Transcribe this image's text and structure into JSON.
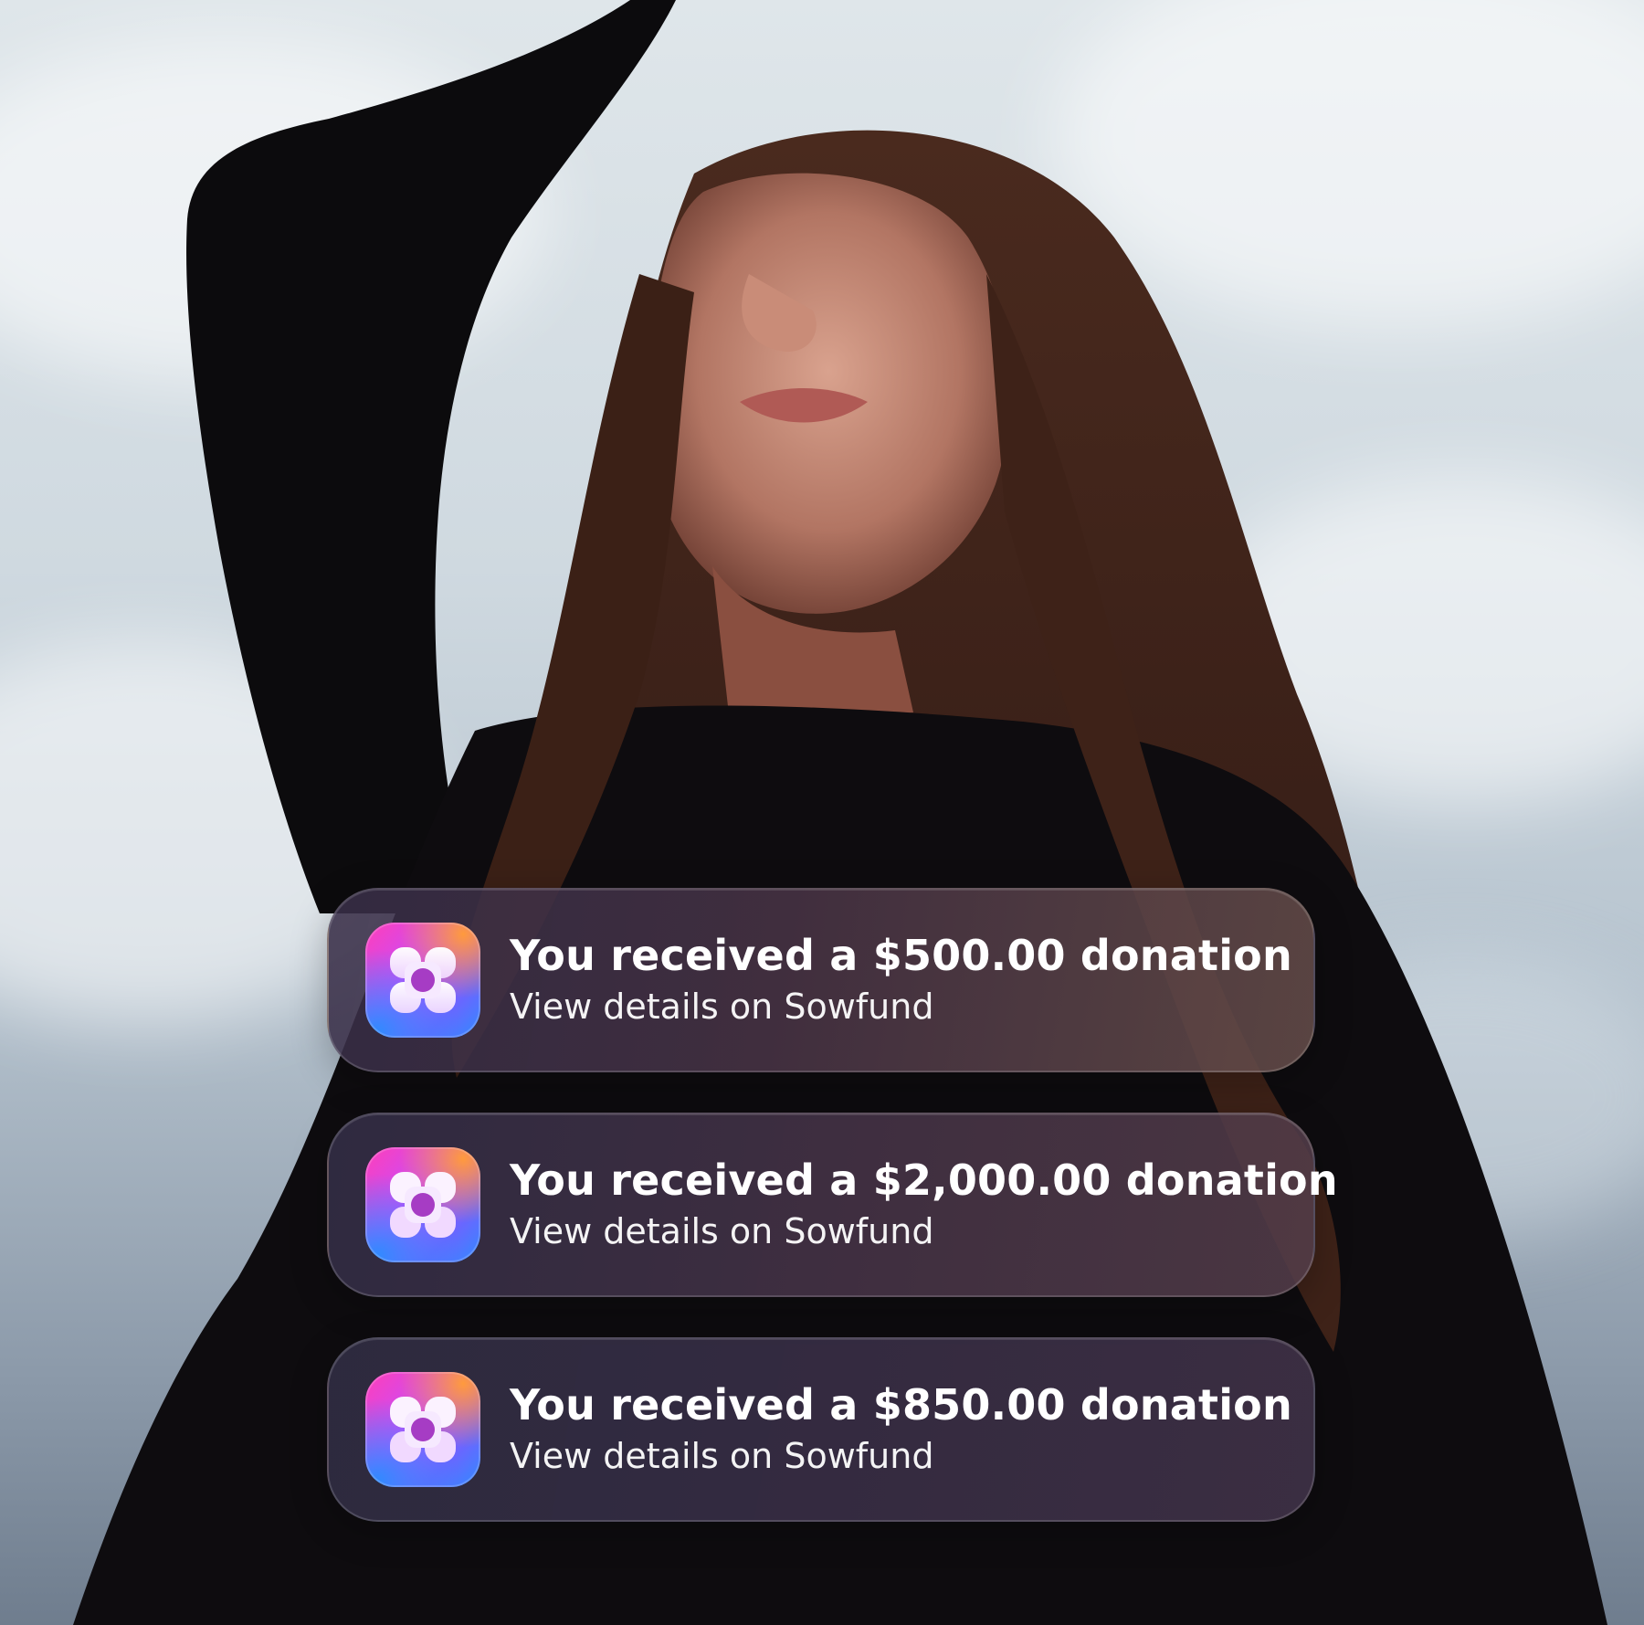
{
  "notifications": [
    {
      "title": "You received a $500.00 donation",
      "subtitle": "View details on Sowfund",
      "app_icon": "sowfund-flower-icon"
    },
    {
      "title": "You received a $2,000.00 donation",
      "subtitle": "View details on Sowfund",
      "app_icon": "sowfund-flower-icon"
    },
    {
      "title": "You received a $850.00 donation",
      "subtitle": "View details on Sowfund",
      "app_icon": "sowfund-flower-icon"
    }
  ],
  "colors": {
    "icon_gradient": [
      "#ff3fb8",
      "#c54cff",
      "#6a66ff",
      "#2f8bff",
      "#ff9a3d"
    ],
    "notification_bg": "#3a2e48",
    "text": "#ffffff"
  }
}
